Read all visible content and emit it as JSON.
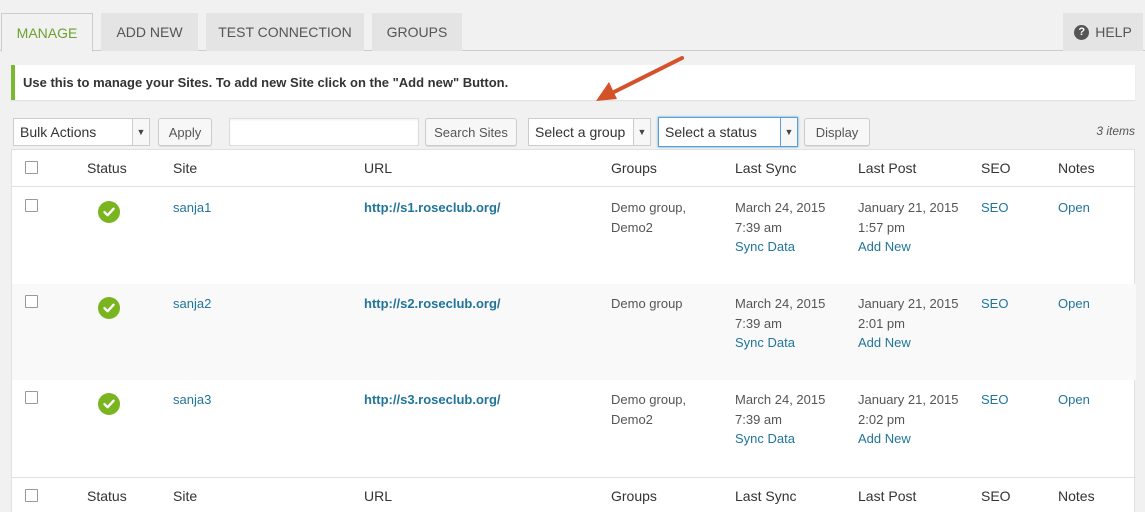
{
  "tabs": {
    "manage": "MANAGE",
    "add_new": "ADD NEW",
    "test_connection": "TEST CONNECTION",
    "groups": "GROUPS",
    "help": "HELP"
  },
  "notice": "Use this to manage your Sites. To add new Site click on the \"Add new\" Button.",
  "toolbar": {
    "bulk_actions": "Bulk Actions",
    "apply": "Apply",
    "search_value": "",
    "search_sites": "Search Sites",
    "select_group": "Select a group",
    "select_status": "Select a status",
    "display": "Display",
    "items_count": "3 items"
  },
  "columns": {
    "status": "Status",
    "site": "Site",
    "url": "URL",
    "groups": "Groups",
    "last_sync": "Last Sync",
    "last_post": "Last Post",
    "seo": "SEO",
    "notes": "Notes"
  },
  "rows": [
    {
      "site": "sanja1",
      "url": "http://s1.roseclub.org/",
      "groups_line1": "Demo group,",
      "groups_line2": "Demo2",
      "last_sync_date": "March 24, 2015",
      "last_sync_time": "7:39 am",
      "sync_link": "Sync Data",
      "last_post_date": "January 21, 2015",
      "last_post_time": "1:57 pm",
      "add_new_link": "Add New",
      "seo": "SEO",
      "notes": "Open"
    },
    {
      "site": "sanja2",
      "url": "http://s2.roseclub.org/",
      "groups_line1": "Demo group",
      "groups_line2": "",
      "last_sync_date": "March 24, 2015",
      "last_sync_time": "7:39 am",
      "sync_link": "Sync Data",
      "last_post_date": "January 21, 2015",
      "last_post_time": "2:01 pm",
      "add_new_link": "Add New",
      "seo": "SEO",
      "notes": "Open"
    },
    {
      "site": "sanja3",
      "url": "http://s3.roseclub.org/",
      "groups_line1": "Demo group,",
      "groups_line2": "Demo2",
      "last_sync_date": "March 24, 2015",
      "last_sync_time": "7:39 am",
      "sync_link": "Sync Data",
      "last_post_date": "January 21, 2015",
      "last_post_time": "2:02 pm",
      "add_new_link": "Add New",
      "seo": "SEO",
      "notes": "Open"
    }
  ],
  "icons": {
    "status": "check-circle-icon",
    "help": "help-icon",
    "annotation": "arrow-annotation"
  },
  "colors": {
    "accent_green": "#6ba130",
    "status_green": "#7ab41f",
    "link_blue": "#21759b",
    "arrow_orange": "#d4522a"
  }
}
